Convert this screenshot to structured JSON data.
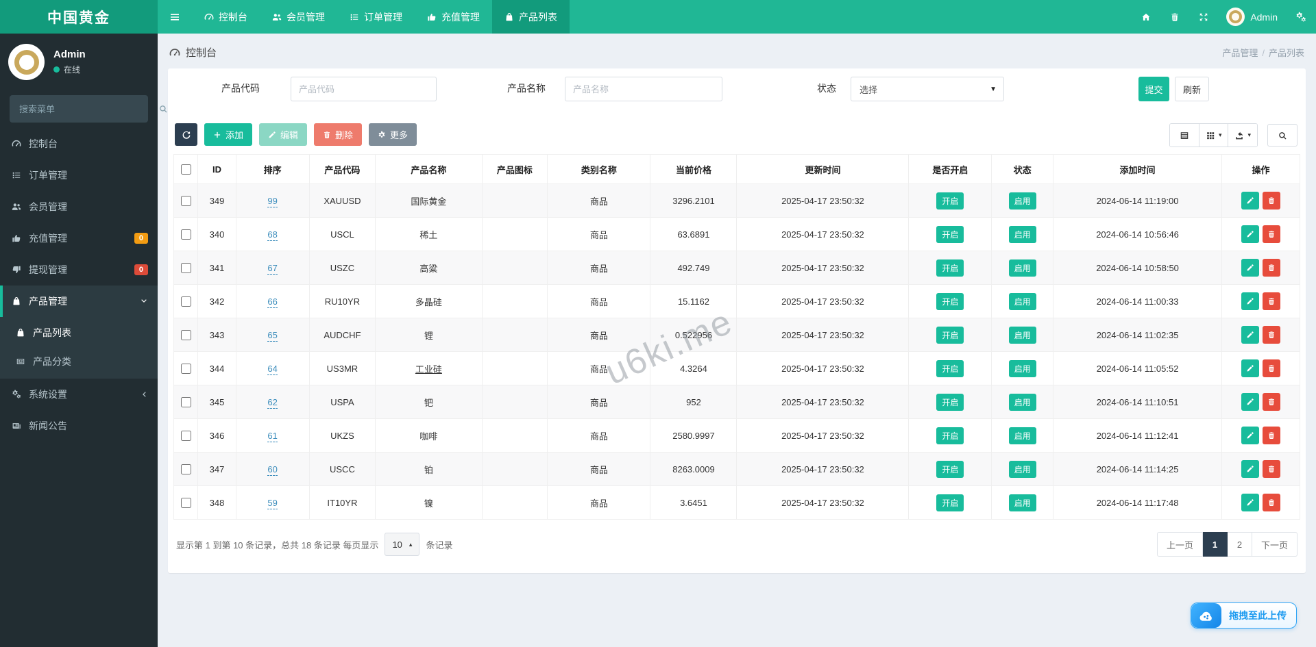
{
  "brand": {
    "title": "中国黄金"
  },
  "colors": {
    "navbar": "#20b795",
    "navbar_dark": "#129b7c",
    "sidebar": "#222d32",
    "accent_teal": "#18bc9c",
    "dark_navy": "#2c3e50",
    "badge_orange": "#f39c12",
    "badge_red": "#dd4b39",
    "delete_red": "#e74c3c",
    "link_blue": "#3c8dbc",
    "upload_blue": "#2196f3"
  },
  "topnav": {
    "items": [
      {
        "label": "控制台",
        "icon": "gauge",
        "active": false
      },
      {
        "label": "会员管理",
        "icon": "users",
        "active": false
      },
      {
        "label": "订单管理",
        "icon": "list",
        "active": false
      },
      {
        "label": "充值管理",
        "icon": "thumb-up",
        "active": false
      },
      {
        "label": "产品列表",
        "icon": "bag",
        "active": true
      }
    ],
    "user_name": "Admin",
    "right_icons": [
      "home",
      "trash",
      "expand",
      "cogs"
    ]
  },
  "sidebar": {
    "user": {
      "name": "Admin",
      "status": "在线"
    },
    "search_placeholder": "搜索菜单",
    "items": [
      {
        "label": "控制台",
        "icon": "gauge"
      },
      {
        "label": "订单管理",
        "icon": "list"
      },
      {
        "label": "会员管理",
        "icon": "users"
      },
      {
        "label": "充值管理",
        "icon": "thumb-up",
        "badge": "0",
        "badge_color": "#f39c12"
      },
      {
        "label": "提现管理",
        "icon": "thumb-down",
        "badge": "0",
        "badge_color": "#dd4b39"
      },
      {
        "label": "产品管理",
        "icon": "bag",
        "open": true,
        "chevron": "down",
        "children": [
          {
            "label": "产品列表",
            "icon": "bag",
            "active": true
          },
          {
            "label": "产品分类",
            "icon": "card",
            "active": false
          }
        ]
      },
      {
        "label": "系统设置",
        "icon": "cogs",
        "chevron": "left"
      },
      {
        "label": "新闻公告",
        "icon": "news"
      }
    ]
  },
  "content": {
    "page_title": "控制台",
    "breadcrumb": {
      "parts": [
        "产品管理",
        "产品列表"
      ],
      "separator": "/"
    },
    "filters": {
      "code_label": "产品代码",
      "code_placeholder": "产品代码",
      "name_label": "产品名称",
      "name_placeholder": "产品名称",
      "status_label": "状态",
      "status_value": "选择",
      "submit_label": "提交",
      "refresh_label": "刷新"
    },
    "toolbar": {
      "add_label": "添加",
      "edit_label": "编辑",
      "delete_label": "删除",
      "more_label": "更多",
      "view_icons": [
        "table-list",
        "grid",
        "export",
        "search"
      ]
    },
    "table": {
      "headers": [
        "ID",
        "排序",
        "产品代码",
        "产品名称",
        "产品图标",
        "类别名称",
        "当前价格",
        "更新时间",
        "是否开启",
        "状态",
        "添加时间",
        "操作"
      ],
      "open_badge": "开启",
      "status_badge": "启用",
      "rows": [
        {
          "id": "349",
          "sort": "99",
          "code": "XAUUSD",
          "name": "国际黄金",
          "category": "商品",
          "price": "3296.2101",
          "updated": "2025-04-17 23:50:32",
          "added": "2024-06-14 11:19:00"
        },
        {
          "id": "340",
          "sort": "68",
          "code": "USCL",
          "name": "稀土",
          "category": "商品",
          "price": "63.6891",
          "updated": "2025-04-17 23:50:32",
          "added": "2024-06-14 10:56:46"
        },
        {
          "id": "341",
          "sort": "67",
          "code": "USZC",
          "name": "高粱",
          "category": "商品",
          "price": "492.749",
          "updated": "2025-04-17 23:50:32",
          "added": "2024-06-14 10:58:50"
        },
        {
          "id": "342",
          "sort": "66",
          "code": "RU10YR",
          "name": "多晶硅",
          "category": "商品",
          "price": "15.1162",
          "updated": "2025-04-17 23:50:32",
          "added": "2024-06-14 11:00:33"
        },
        {
          "id": "343",
          "sort": "65",
          "code": "AUDCHF",
          "name": "锂",
          "category": "商品",
          "price": "0.522956",
          "updated": "2025-04-17 23:50:32",
          "added": "2024-06-14 11:02:35"
        },
        {
          "id": "344",
          "sort": "64",
          "code": "US3MR",
          "name": "工业硅",
          "underline": true,
          "category": "商品",
          "price": "4.3264",
          "updated": "2025-04-17 23:50:32",
          "added": "2024-06-14 11:05:52"
        },
        {
          "id": "345",
          "sort": "62",
          "code": "USPA",
          "name": "钯",
          "category": "商品",
          "price": "952",
          "updated": "2025-04-17 23:50:32",
          "added": "2024-06-14 11:10:51"
        },
        {
          "id": "346",
          "sort": "61",
          "code": "UKZS",
          "name": "咖啡",
          "category": "商品",
          "price": "2580.9997",
          "updated": "2025-04-17 23:50:32",
          "added": "2024-06-14 11:12:41"
        },
        {
          "id": "347",
          "sort": "60",
          "code": "USCC",
          "name": "铂",
          "category": "商品",
          "price": "8263.0009",
          "updated": "2025-04-17 23:50:32",
          "added": "2024-06-14 11:14:25"
        },
        {
          "id": "348",
          "sort": "59",
          "code": "IT10YR",
          "name": "镍",
          "category": "商品",
          "price": "3.6451",
          "updated": "2025-04-17 23:50:32",
          "added": "2024-06-14 11:17:48"
        }
      ]
    },
    "pagination": {
      "info_prefix": "显示第 1 到第 10 条记录，总共 18 条记录 每页显示",
      "page_size": "10",
      "info_suffix": "条记录",
      "prev_label": "上一页",
      "pages": [
        {
          "label": "1",
          "active": true
        },
        {
          "label": "2",
          "active": false
        }
      ],
      "next_label": "下一页"
    },
    "upload_label": "拖拽至此上传",
    "watermark": "u6ki.me"
  }
}
